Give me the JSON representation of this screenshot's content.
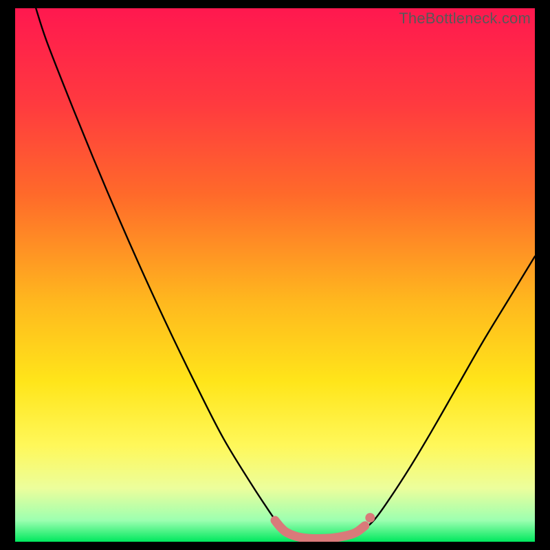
{
  "watermark": "TheBottleneck.com",
  "chart_data": {
    "type": "line",
    "title": "",
    "xlabel": "",
    "ylabel": "",
    "xlim": [
      0,
      100
    ],
    "ylim": [
      0,
      100
    ],
    "gradient_stops": [
      {
        "offset": 0,
        "color": "#ff184f"
      },
      {
        "offset": 18,
        "color": "#ff3a3f"
      },
      {
        "offset": 35,
        "color": "#ff6a2a"
      },
      {
        "offset": 55,
        "color": "#ffb81e"
      },
      {
        "offset": 70,
        "color": "#ffe51a"
      },
      {
        "offset": 82,
        "color": "#fff85a"
      },
      {
        "offset": 90,
        "color": "#ecfe9c"
      },
      {
        "offset": 96,
        "color": "#9cffb0"
      },
      {
        "offset": 100,
        "color": "#00e85e"
      }
    ],
    "series": [
      {
        "name": "bottleneck-curve",
        "color": "#000000",
        "points": [
          {
            "x": 4.0,
            "y": 100.0
          },
          {
            "x": 6.0,
            "y": 94.0
          },
          {
            "x": 10.0,
            "y": 84.0
          },
          {
            "x": 15.0,
            "y": 72.0
          },
          {
            "x": 20.0,
            "y": 60.5
          },
          {
            "x": 25.0,
            "y": 49.5
          },
          {
            "x": 30.0,
            "y": 39.0
          },
          {
            "x": 35.0,
            "y": 29.0
          },
          {
            "x": 40.0,
            "y": 19.5
          },
          {
            "x": 45.0,
            "y": 11.5
          },
          {
            "x": 48.0,
            "y": 7.0
          },
          {
            "x": 50.5,
            "y": 3.5
          },
          {
            "x": 52.5,
            "y": 1.5
          },
          {
            "x": 55.0,
            "y": 0.6
          },
          {
            "x": 58.0,
            "y": 0.4
          },
          {
            "x": 61.0,
            "y": 0.5
          },
          {
            "x": 64.0,
            "y": 0.9
          },
          {
            "x": 66.5,
            "y": 2.0
          },
          {
            "x": 69.0,
            "y": 4.0
          },
          {
            "x": 72.0,
            "y": 8.0
          },
          {
            "x": 76.0,
            "y": 14.0
          },
          {
            "x": 80.0,
            "y": 20.5
          },
          {
            "x": 85.0,
            "y": 29.0
          },
          {
            "x": 90.0,
            "y": 37.5
          },
          {
            "x": 95.0,
            "y": 45.5
          },
          {
            "x": 100.0,
            "y": 53.5
          }
        ]
      },
      {
        "name": "optimal-range-marker",
        "color": "#d97a7a",
        "points": [
          {
            "x": 50.0,
            "y": 4.0
          },
          {
            "x": 51.0,
            "y": 2.8
          },
          {
            "x": 52.0,
            "y": 1.9
          },
          {
            "x": 53.5,
            "y": 1.2
          },
          {
            "x": 55.0,
            "y": 0.8
          },
          {
            "x": 57.0,
            "y": 0.6
          },
          {
            "x": 59.0,
            "y": 0.6
          },
          {
            "x": 61.0,
            "y": 0.7
          },
          {
            "x": 63.0,
            "y": 1.0
          },
          {
            "x": 65.0,
            "y": 1.5
          },
          {
            "x": 66.0,
            "y": 2.0
          },
          {
            "x": 67.3,
            "y": 3.0
          }
        ],
        "end_dot": {
          "x": 68.3,
          "y": 4.5
        }
      }
    ]
  }
}
